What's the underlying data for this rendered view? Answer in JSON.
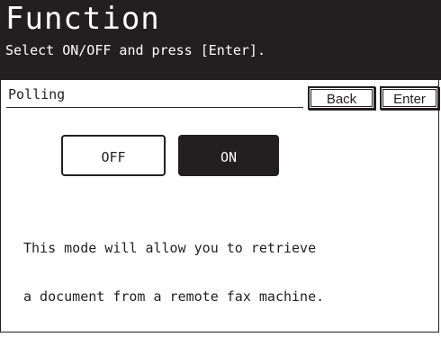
{
  "header": {
    "title": "Function",
    "subtitle": "Select ON/OFF and press [Enter]."
  },
  "section": {
    "label": "Polling"
  },
  "nav": {
    "back_label": "Back",
    "enter_label": "Enter"
  },
  "toggle": {
    "off_label": "OFF",
    "on_label": "ON",
    "selected": "ON"
  },
  "description": {
    "line1": "This mode will allow you to retrieve",
    "line2": "a document from a remote fax machine."
  },
  "colors": {
    "dark": "#231f20",
    "light": "#ffffff"
  }
}
